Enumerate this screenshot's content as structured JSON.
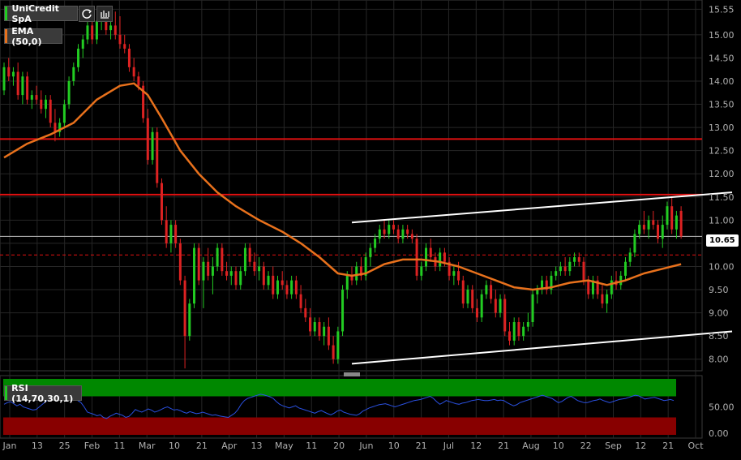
{
  "colors": {
    "background": "#000000",
    "up": "#22cc22",
    "down": "#dd2222",
    "ema": "#e8711c",
    "resistance": "#e01010",
    "channel": "#ffffff",
    "rsi_line": "#2a50e0",
    "overbought": "#008800",
    "oversold": "#880000",
    "grid": "#262626",
    "axis_text": "#b0b0b0"
  },
  "header": {
    "symbol": "UniCredit SpA",
    "ema_label": "EMA (50,0)",
    "rsi_label": "RSI (14,70,30,1)",
    "icons": [
      "refresh-icon",
      "bar-chart-icon"
    ]
  },
  "price_tag": "10.65",
  "chart_data": {
    "type": "candlestick",
    "y_ticks": [
      "15.55",
      "15.00",
      "14.50",
      "14.00",
      "13.50",
      "13.00",
      "12.50",
      "12.00",
      "11.50",
      "11.00",
      "10.50",
      "10.00",
      "9.50",
      "9.00",
      "8.50",
      "8.00"
    ],
    "ylim": [
      7.75,
      15.75
    ],
    "x_ticks": [
      "Jan",
      "13",
      "25",
      "Feb",
      "11",
      "Mar",
      "10",
      "21",
      "Apr",
      "13",
      "May",
      "11",
      "20",
      "Jun",
      "10",
      "21",
      "Jul",
      "12",
      "21",
      "Aug",
      "10",
      "22",
      "Sep",
      "12",
      "21",
      "Oct"
    ],
    "horizontal_levels": [
      {
        "value": 12.75,
        "kind": "resistance"
      },
      {
        "value": 11.55,
        "kind": "resistance"
      },
      {
        "value": 10.65,
        "kind": "last-price"
      },
      {
        "value": 10.25,
        "kind": "dashed-resistance"
      }
    ],
    "trend_channel": {
      "upper": [
        [
          75,
          10.95
        ],
        [
          157,
          11.6
        ]
      ],
      "lower": [
        [
          75,
          7.9
        ],
        [
          157,
          8.6
        ]
      ]
    },
    "candles": [
      [
        0,
        13.8,
        14.4,
        13.7,
        14.3
      ],
      [
        1,
        14.3,
        14.5,
        14.0,
        14.1
      ],
      [
        2,
        14.1,
        14.3,
        13.9,
        14.2
      ],
      [
        3,
        14.2,
        14.4,
        13.6,
        13.7
      ],
      [
        4,
        13.7,
        14.2,
        13.5,
        14.1
      ],
      [
        5,
        14.1,
        14.2,
        13.5,
        13.6
      ],
      [
        6,
        13.6,
        13.8,
        13.4,
        13.7
      ],
      [
        7,
        13.7,
        13.9,
        13.5,
        13.6
      ],
      [
        8,
        13.6,
        13.8,
        13.3,
        13.4
      ],
      [
        9,
        13.4,
        13.7,
        13.2,
        13.6
      ],
      [
        10,
        13.6,
        13.7,
        13.0,
        13.1
      ],
      [
        11,
        13.1,
        13.4,
        12.7,
        12.9
      ],
      [
        12,
        12.9,
        13.2,
        12.8,
        13.1
      ],
      [
        13,
        13.1,
        13.6,
        13.0,
        13.5
      ],
      [
        14,
        13.5,
        14.1,
        13.4,
        14.0
      ],
      [
        15,
        14.0,
        14.4,
        13.9,
        14.3
      ],
      [
        16,
        14.3,
        14.8,
        14.2,
        14.7
      ],
      [
        17,
        14.7,
        15.0,
        14.5,
        14.9
      ],
      [
        18,
        14.9,
        15.3,
        14.8,
        15.2
      ],
      [
        19,
        15.2,
        15.4,
        14.8,
        14.9
      ],
      [
        20,
        14.9,
        15.3,
        14.8,
        15.3
      ],
      [
        21,
        15.3,
        15.6,
        15.1,
        15.4
      ],
      [
        22,
        15.4,
        15.6,
        15.0,
        15.1
      ],
      [
        23,
        15.1,
        15.3,
        14.9,
        15.2
      ],
      [
        24,
        15.2,
        15.5,
        14.9,
        15.0
      ],
      [
        25,
        15.0,
        15.4,
        14.7,
        14.8
      ],
      [
        26,
        14.8,
        15.0,
        14.6,
        14.7
      ],
      [
        27,
        14.7,
        14.8,
        14.2,
        14.3
      ],
      [
        28,
        14.3,
        14.5,
        14.0,
        14.1
      ],
      [
        29,
        14.1,
        14.2,
        13.8,
        13.9
      ],
      [
        30,
        13.9,
        14.0,
        13.1,
        13.2
      ],
      [
        31,
        13.2,
        13.4,
        12.2,
        12.3
      ],
      [
        32,
        12.3,
        13.0,
        12.2,
        12.9
      ],
      [
        33,
        12.9,
        13.0,
        11.7,
        11.8
      ],
      [
        34,
        11.8,
        11.9,
        10.9,
        11.0
      ],
      [
        35,
        11.0,
        11.3,
        10.4,
        10.5
      ],
      [
        36,
        10.5,
        11.0,
        10.3,
        10.9
      ],
      [
        37,
        10.9,
        11.0,
        10.4,
        10.5
      ],
      [
        38,
        10.5,
        10.6,
        9.6,
        9.7
      ],
      [
        39,
        9.7,
        9.8,
        7.8,
        8.5
      ],
      [
        40,
        8.5,
        9.3,
        8.4,
        9.2
      ],
      [
        41,
        9.2,
        10.5,
        9.1,
        10.4
      ],
      [
        42,
        10.4,
        10.5,
        9.6,
        9.7
      ],
      [
        43,
        9.7,
        10.2,
        9.1,
        10.1
      ],
      [
        44,
        10.1,
        10.4,
        9.7,
        9.8
      ],
      [
        45,
        9.8,
        10.2,
        9.4,
        10.0
      ],
      [
        46,
        10.0,
        10.5,
        9.9,
        10.4
      ],
      [
        47,
        10.4,
        10.5,
        9.8,
        9.9
      ],
      [
        48,
        9.9,
        10.1,
        9.7,
        9.8
      ],
      [
        49,
        9.8,
        10.0,
        9.6,
        9.9
      ],
      [
        50,
        9.9,
        10.0,
        9.5,
        9.6
      ],
      [
        51,
        9.6,
        10.0,
        9.5,
        9.9
      ],
      [
        52,
        9.9,
        10.5,
        9.8,
        10.4
      ],
      [
        53,
        10.4,
        10.5,
        10.0,
        10.1
      ],
      [
        54,
        10.1,
        10.3,
        9.8,
        9.9
      ],
      [
        55,
        9.9,
        10.2,
        9.7,
        10.0
      ],
      [
        56,
        10.0,
        10.1,
        9.5,
        9.6
      ],
      [
        57,
        9.6,
        9.9,
        9.5,
        9.8
      ],
      [
        58,
        9.8,
        10.0,
        9.3,
        9.4
      ],
      [
        59,
        9.4,
        9.8,
        9.3,
        9.7
      ],
      [
        60,
        9.7,
        9.9,
        9.5,
        9.6
      ],
      [
        61,
        9.6,
        9.7,
        9.3,
        9.4
      ],
      [
        62,
        9.4,
        9.8,
        9.3,
        9.7
      ],
      [
        63,
        9.7,
        9.8,
        9.3,
        9.4
      ],
      [
        64,
        9.4,
        9.6,
        9.0,
        9.1
      ],
      [
        65,
        9.1,
        9.3,
        8.8,
        8.9
      ],
      [
        66,
        8.9,
        9.1,
        8.5,
        8.6
      ],
      [
        67,
        8.6,
        8.9,
        8.5,
        8.8
      ],
      [
        68,
        8.8,
        8.9,
        8.4,
        8.5
      ],
      [
        69,
        8.5,
        8.8,
        8.3,
        8.7
      ],
      [
        70,
        8.7,
        8.9,
        8.2,
        8.3
      ],
      [
        71,
        8.3,
        8.5,
        7.9,
        8.0
      ],
      [
        72,
        8.0,
        8.7,
        7.9,
        8.6
      ],
      [
        73,
        8.6,
        9.6,
        8.5,
        9.5
      ],
      [
        74,
        9.5,
        9.9,
        9.3,
        9.8
      ],
      [
        75,
        9.8,
        10.0,
        9.6,
        9.7
      ],
      [
        76,
        9.7,
        10.1,
        9.6,
        10.0
      ],
      [
        77,
        10.0,
        10.2,
        9.7,
        9.8
      ],
      [
        78,
        9.8,
        10.3,
        9.7,
        10.2
      ],
      [
        79,
        10.2,
        10.5,
        10.0,
        10.4
      ],
      [
        80,
        10.4,
        10.7,
        10.3,
        10.6
      ],
      [
        81,
        10.6,
        10.9,
        10.5,
        10.8
      ],
      [
        82,
        10.8,
        11.0,
        10.6,
        10.7
      ],
      [
        83,
        10.7,
        11.0,
        10.6,
        10.9
      ],
      [
        84,
        10.9,
        11.0,
        10.7,
        10.8
      ],
      [
        85,
        10.8,
        10.9,
        10.5,
        10.6
      ],
      [
        86,
        10.6,
        10.9,
        10.5,
        10.8
      ],
      [
        87,
        10.8,
        10.9,
        10.6,
        10.7
      ],
      [
        88,
        10.7,
        10.8,
        10.5,
        10.6
      ],
      [
        89,
        10.6,
        10.7,
        9.7,
        9.8
      ],
      [
        90,
        9.8,
        10.1,
        9.7,
        10.0
      ],
      [
        91,
        10.0,
        10.5,
        9.9,
        10.4
      ],
      [
        92,
        10.4,
        10.6,
        10.1,
        10.2
      ],
      [
        93,
        10.2,
        10.3,
        9.9,
        10.0
      ],
      [
        94,
        10.0,
        10.4,
        9.9,
        10.3
      ],
      [
        95,
        10.3,
        10.4,
        10.0,
        10.1
      ],
      [
        96,
        10.1,
        10.2,
        9.7,
        9.8
      ],
      [
        97,
        9.8,
        10.0,
        9.6,
        9.9
      ],
      [
        98,
        9.9,
        10.1,
        9.6,
        9.7
      ],
      [
        99,
        9.7,
        9.8,
        9.1,
        9.2
      ],
      [
        100,
        9.2,
        9.6,
        9.1,
        9.5
      ],
      [
        101,
        9.5,
        9.6,
        9.0,
        9.1
      ],
      [
        102,
        9.1,
        9.3,
        8.8,
        8.9
      ],
      [
        103,
        8.9,
        9.5,
        8.8,
        9.4
      ],
      [
        104,
        9.4,
        9.7,
        9.3,
        9.6
      ],
      [
        105,
        9.6,
        9.7,
        9.2,
        9.3
      ],
      [
        106,
        9.3,
        9.5,
        8.9,
        9.0
      ],
      [
        107,
        9.0,
        9.4,
        8.9,
        9.3
      ],
      [
        108,
        9.3,
        9.4,
        8.5,
        8.6
      ],
      [
        109,
        8.6,
        8.8,
        8.3,
        8.4
      ],
      [
        110,
        8.4,
        8.9,
        8.3,
        8.8
      ],
      [
        111,
        8.8,
        8.9,
        8.4,
        8.5
      ],
      [
        112,
        8.5,
        8.8,
        8.4,
        8.7
      ],
      [
        113,
        8.7,
        9.0,
        8.6,
        8.8
      ],
      [
        114,
        8.8,
        9.5,
        8.7,
        9.4
      ],
      [
        115,
        9.4,
        9.6,
        9.2,
        9.5
      ],
      [
        116,
        9.5,
        9.8,
        9.4,
        9.7
      ],
      [
        117,
        9.7,
        9.8,
        9.4,
        9.5
      ],
      [
        118,
        9.5,
        9.9,
        9.4,
        9.8
      ],
      [
        119,
        9.8,
        10.0,
        9.7,
        9.9
      ],
      [
        120,
        9.9,
        10.1,
        9.8,
        10.0
      ],
      [
        121,
        10.0,
        10.2,
        9.8,
        9.9
      ],
      [
        122,
        9.9,
        10.2,
        9.8,
        10.1
      ],
      [
        123,
        10.1,
        10.3,
        10.0,
        10.2
      ],
      [
        124,
        10.2,
        10.3,
        10.0,
        10.1
      ],
      [
        125,
        10.1,
        10.2,
        9.6,
        9.7
      ],
      [
        126,
        9.7,
        9.8,
        9.3,
        9.4
      ],
      [
        127,
        9.4,
        9.8,
        9.3,
        9.7
      ],
      [
        128,
        9.7,
        9.8,
        9.3,
        9.4
      ],
      [
        129,
        9.4,
        9.6,
        9.1,
        9.2
      ],
      [
        130,
        9.2,
        9.5,
        9.0,
        9.4
      ],
      [
        131,
        9.4,
        9.8,
        9.3,
        9.7
      ],
      [
        132,
        9.7,
        9.9,
        9.5,
        9.6
      ],
      [
        133,
        9.6,
        9.9,
        9.5,
        9.8
      ],
      [
        134,
        9.8,
        10.2,
        9.7,
        10.1
      ],
      [
        135,
        10.1,
        10.4,
        10.0,
        10.3
      ],
      [
        136,
        10.3,
        10.8,
        10.2,
        10.7
      ],
      [
        137,
        10.7,
        11.0,
        10.6,
        10.9
      ],
      [
        138,
        10.9,
        11.2,
        10.7,
        10.8
      ],
      [
        139,
        10.8,
        11.1,
        10.6,
        11.0
      ],
      [
        140,
        11.0,
        11.2,
        10.8,
        10.9
      ],
      [
        141,
        10.9,
        11.0,
        10.5,
        10.6
      ],
      [
        142,
        10.6,
        11.1,
        10.4,
        10.9
      ],
      [
        143,
        10.9,
        11.4,
        10.8,
        11.3
      ],
      [
        144,
        11.3,
        11.5,
        10.7,
        10.8
      ],
      [
        145,
        10.8,
        11.2,
        10.6,
        11.1
      ],
      [
        146,
        11.2,
        11.3,
        10.6,
        10.65
      ]
    ],
    "ema_points": [
      [
        0,
        12.35
      ],
      [
        5,
        12.65
      ],
      [
        10,
        12.85
      ],
      [
        15,
        13.1
      ],
      [
        20,
        13.6
      ],
      [
        25,
        13.9
      ],
      [
        28,
        13.95
      ],
      [
        31,
        13.7
      ],
      [
        34,
        13.2
      ],
      [
        38,
        12.5
      ],
      [
        42,
        12.0
      ],
      [
        46,
        11.6
      ],
      [
        50,
        11.3
      ],
      [
        55,
        11.0
      ],
      [
        60,
        10.75
      ],
      [
        64,
        10.5
      ],
      [
        68,
        10.2
      ],
      [
        72,
        9.85
      ],
      [
        75,
        9.8
      ],
      [
        78,
        9.85
      ],
      [
        82,
        10.05
      ],
      [
        86,
        10.15
      ],
      [
        90,
        10.15
      ],
      [
        94,
        10.1
      ],
      [
        98,
        10.0
      ],
      [
        102,
        9.85
      ],
      [
        106,
        9.7
      ],
      [
        110,
        9.55
      ],
      [
        114,
        9.5
      ],
      [
        118,
        9.55
      ],
      [
        122,
        9.65
      ],
      [
        126,
        9.7
      ],
      [
        130,
        9.6
      ],
      [
        134,
        9.7
      ],
      [
        138,
        9.85
      ],
      [
        142,
        9.95
      ],
      [
        146,
        10.05
      ]
    ],
    "rsi": {
      "ylim": [
        0,
        100
      ],
      "y_ticks": [
        "50.00",
        "0.00"
      ],
      "overbought": 70,
      "oversold": 30,
      "values": [
        55,
        58,
        60,
        56,
        52,
        55,
        50,
        48,
        46,
        44,
        45,
        50,
        55,
        60,
        65,
        70,
        72,
        74,
        73,
        70,
        72,
        75,
        68,
        62,
        58,
        50,
        40,
        38,
        36,
        33,
        35,
        30,
        28,
        32,
        35,
        38,
        36,
        34,
        30,
        32,
        38,
        45,
        42,
        40,
        43,
        46,
        44,
        40,
        42,
        45,
        48,
        50,
        47,
        44,
        45,
        43,
        40,
        38,
        41,
        39,
        37,
        38,
        40,
        38,
        36,
        34,
        35,
        33,
        32,
        31,
        30,
        34,
        38,
        45,
        55,
        62,
        66,
        68,
        70,
        72,
        74,
        73,
        71,
        69,
        66,
        60,
        55,
        52,
        50,
        48,
        50,
        52,
        48,
        46,
        44,
        42,
        40,
        38,
        41,
        43,
        40,
        37,
        35,
        38,
        42,
        44,
        40,
        38,
        36,
        35,
        34,
        37,
        42,
        45,
        48,
        50,
        52,
        54,
        55,
        56,
        54,
        52,
        50,
        52,
        54,
        56,
        58,
        60,
        62,
        63,
        64,
        66,
        68,
        70,
        66,
        60,
        55,
        58,
        62,
        60,
        58,
        56,
        55,
        57,
        58,
        60,
        62,
        63,
        64,
        63,
        62,
        62,
        63,
        64,
        62,
        63,
        62,
        58,
        55,
        52,
        54,
        58,
        60,
        62,
        64,
        66,
        68,
        70,
        72,
        70,
        68,
        66,
        62,
        58,
        60,
        64,
        68,
        70,
        66,
        62,
        60,
        58,
        58,
        60,
        62,
        63,
        65,
        62,
        60,
        58,
        60,
        62,
        64,
        65,
        66,
        68,
        70,
        72,
        71,
        68,
        65,
        66,
        67,
        68,
        66,
        64,
        62,
        63,
        64,
        62
      ]
    }
  }
}
